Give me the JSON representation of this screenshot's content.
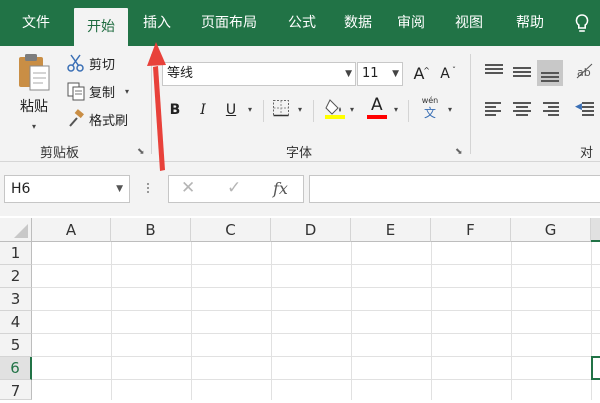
{
  "tabs": [
    "文件",
    "开始",
    "插入",
    "页面布局",
    "公式",
    "数据",
    "审阅",
    "视图",
    "帮助"
  ],
  "clipboard": {
    "paste": "粘贴",
    "cut": "剪切",
    "copy": "复制",
    "format_painter": "格式刷",
    "group": "剪贴板"
  },
  "font": {
    "name": "等线",
    "size": "11",
    "bold": "B",
    "italic": "I",
    "underline": "U",
    "font_color_letter": "A",
    "grow": "A",
    "shrink": "A",
    "phonetic_top": "wén",
    "phonetic_bottom": "文",
    "group": "字体"
  },
  "alignment": {
    "group": "对齐"
  },
  "formula_bar": {
    "name_box": "H6",
    "cancel": "✕",
    "enter": "✓",
    "fx": "fx",
    "value": ""
  },
  "columns": [
    "A",
    "B",
    "C",
    "D",
    "E",
    "F",
    "G"
  ],
  "rows": [
    "1",
    "2",
    "3",
    "4",
    "5",
    "6",
    "7"
  ],
  "selected_cell": "H6",
  "colors": {
    "brand": "#217346",
    "highlight_yellow": "#ffff00",
    "font_red": "#ff0000",
    "annotation_arrow": "#e8413a"
  }
}
